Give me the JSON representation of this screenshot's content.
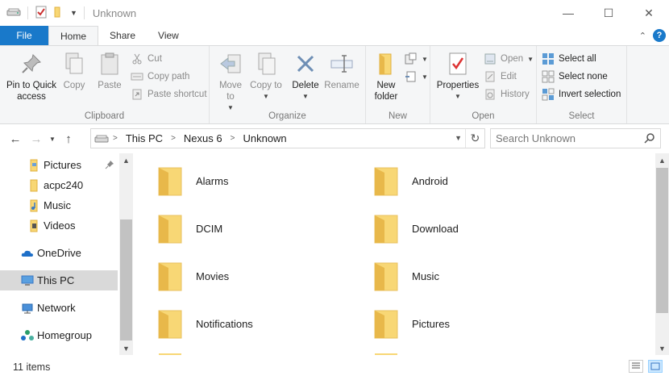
{
  "window": {
    "title": "Unknown",
    "controls": {
      "minimize": "—",
      "maximize": "☐",
      "close": "✕"
    }
  },
  "ribbon_tabs": {
    "file": "File",
    "home": "Home",
    "share": "Share",
    "view": "View",
    "help": "?"
  },
  "ribbon": {
    "clipboard": {
      "label": "Clipboard",
      "pin_quick_access": "Pin to Quick access",
      "copy": "Copy",
      "paste": "Paste",
      "cut": "Cut",
      "copy_path": "Copy path",
      "paste_shortcut": "Paste shortcut"
    },
    "organize": {
      "label": "Organize",
      "move_to": "Move to",
      "copy_to": "Copy to",
      "delete": "Delete",
      "rename": "Rename"
    },
    "new": {
      "label": "New",
      "new_folder": "New folder"
    },
    "open": {
      "label": "Open",
      "properties": "Properties",
      "open": "Open",
      "edit": "Edit",
      "history": "History"
    },
    "select": {
      "label": "Select",
      "select_all": "Select all",
      "select_none": "Select none",
      "invert_selection": "Invert selection"
    }
  },
  "address": {
    "path": [
      "This PC",
      "Nexus 6",
      "Unknown"
    ],
    "search_placeholder": "Search Unknown"
  },
  "nav_pane": {
    "items": [
      {
        "label": "Pictures",
        "icon": "pictures-folder-icon",
        "pinned": true
      },
      {
        "label": "acpc240",
        "icon": "folder-icon"
      },
      {
        "label": "Music",
        "icon": "music-folder-icon"
      },
      {
        "label": "Videos",
        "icon": "videos-folder-icon"
      },
      {
        "label": "OneDrive",
        "icon": "onedrive-icon"
      },
      {
        "label": "This PC",
        "icon": "this-pc-icon",
        "selected": true
      },
      {
        "label": "Network",
        "icon": "network-icon"
      },
      {
        "label": "Homegroup",
        "icon": "homegroup-icon"
      }
    ]
  },
  "folders": [
    {
      "name": "Alarms"
    },
    {
      "name": "Android"
    },
    {
      "name": "DCIM"
    },
    {
      "name": "Download"
    },
    {
      "name": "Movies"
    },
    {
      "name": "Music"
    },
    {
      "name": "Notifications"
    },
    {
      "name": "Pictures"
    }
  ],
  "status": {
    "item_count": "11 items"
  },
  "colors": {
    "accent": "#1979ca",
    "folder": "#f8d775",
    "folder_dark": "#e8b84a",
    "selected_bg": "#d9d9d9"
  }
}
